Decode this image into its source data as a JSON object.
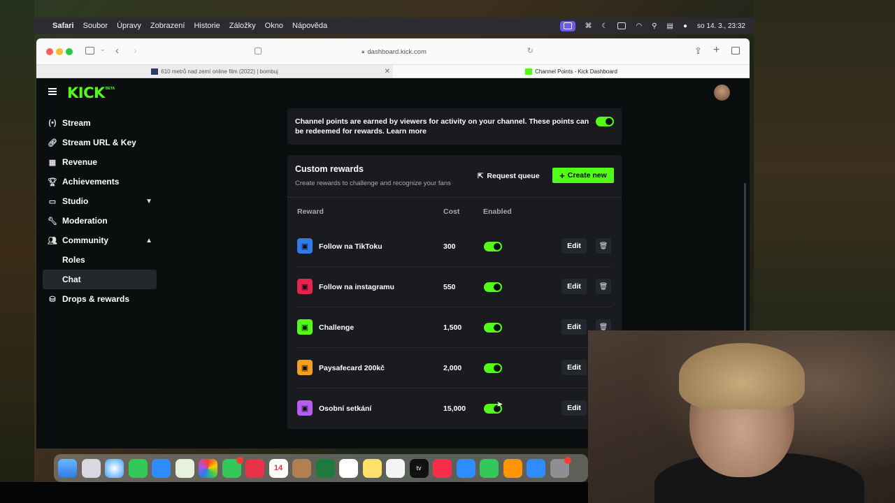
{
  "menubar": {
    "app": "Safari",
    "items": [
      "Soubor",
      "Úpravy",
      "Zobrazení",
      "Historie",
      "Záložky",
      "Okno",
      "Nápověda"
    ],
    "clock": "so 14. 3., 23:32"
  },
  "browser": {
    "url": "dashboard.kick.com",
    "tabs": [
      {
        "title": "610 metrů nad zemí online film (2022) | bombuj"
      },
      {
        "title": "Channel Points - Kick Dashboard"
      }
    ]
  },
  "kick": {
    "logo": "KICK",
    "beta": "BETA"
  },
  "nav": {
    "items": [
      {
        "label": "Stream",
        "icon": "broadcast-icon"
      },
      {
        "label": "Stream URL & Key",
        "icon": "link-icon"
      },
      {
        "label": "Revenue",
        "icon": "chart-icon"
      },
      {
        "label": "Achievements",
        "icon": "trophy-icon"
      },
      {
        "label": "Studio",
        "icon": "studio-icon"
      },
      {
        "label": "Moderation",
        "icon": "wrench-icon"
      },
      {
        "label": "Community",
        "icon": "people-icon"
      },
      {
        "label": "Roles"
      },
      {
        "label": "Chat"
      },
      {
        "label": "Drops & rewards",
        "icon": "gift-icon"
      }
    ]
  },
  "info": {
    "text": "Channel points are earned by viewers for activity on your channel. These points can be redeemed for rewards.",
    "learn_more": "Learn more"
  },
  "rewards": {
    "title": "Custom rewards",
    "subtitle": "Create rewards to challenge and recognize your fans",
    "request_queue": "Request queue",
    "create_new": "Create new",
    "columns": {
      "reward": "Reward",
      "cost": "Cost",
      "enabled": "Enabled"
    },
    "edit_label": "Edit",
    "rows": [
      {
        "name": "Follow na TikToku",
        "cost": "300",
        "enabled": true,
        "color": "#2f7be8"
      },
      {
        "name": "Follow na instagramu",
        "cost": "550",
        "enabled": true,
        "color": "#e8234e"
      },
      {
        "name": "Challenge",
        "cost": "1,500",
        "enabled": true,
        "color": "#53fc18"
      },
      {
        "name": "Paysafecard 200kč",
        "cost": "2,000",
        "enabled": true,
        "color": "#f59e1b"
      },
      {
        "name": "Osobní setkání",
        "cost": "15,000",
        "enabled": true,
        "color": "#b65cf0"
      }
    ]
  },
  "dock": {
    "calendar_day": "14",
    "tv_label": "tv"
  },
  "colors": {
    "accent": "#53fc18",
    "page_bg": "#0b0e0f",
    "card_bg": "#191b1f"
  }
}
